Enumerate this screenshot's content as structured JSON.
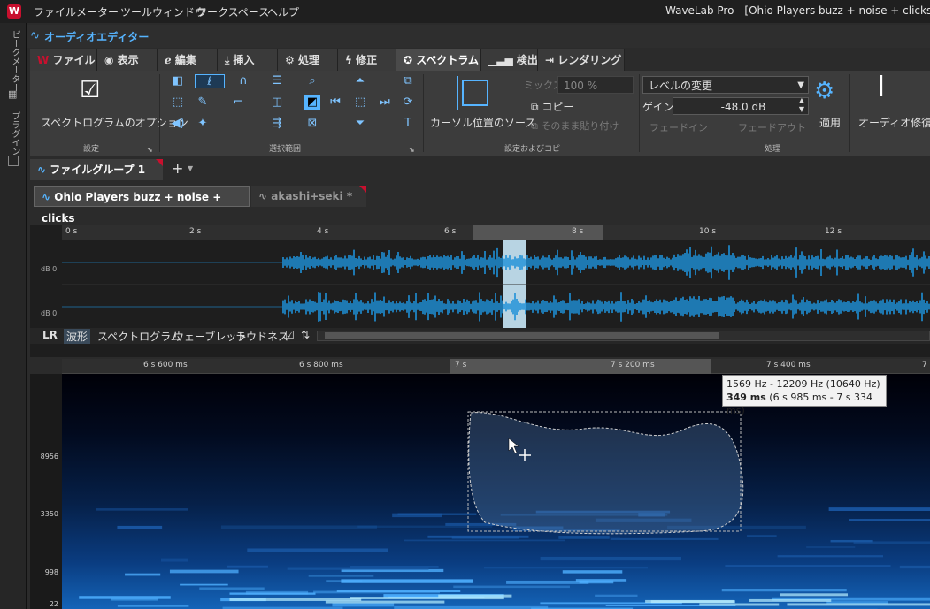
{
  "window": {
    "app_title": "WaveLab Pro - [Ohio Players buzz + noise + clicks.wav (C",
    "menus": [
      "ファイル",
      "メーター",
      "ツールウィンドウ",
      "ワークスペース",
      "ヘルプ"
    ]
  },
  "left_strip": {
    "label_meters": "ピークメーター",
    "label_plugins": "プラグイン"
  },
  "editor": {
    "title": "オーディオエディター",
    "tabs": [
      "ファイル",
      "表示",
      "編集",
      "挿入",
      "処理",
      "修正",
      "スペクトラム",
      "検出",
      "レンダリング"
    ],
    "active_tab": "スペクトラム"
  },
  "ribbon": {
    "spectrogram_options": "スペクトログラムのオプション",
    "group_settings": "設定",
    "group_selection": "選択範囲",
    "cursor_source": "カーソル位置のソース",
    "mix_label": "ミックス",
    "mix_value": "100 %",
    "copy_label": "コピー",
    "paste_as_is": "そのまま貼り付け",
    "group_settings_copy": "設定およびコピー",
    "process_select": "レベルの変更",
    "gain_label": "ゲイン",
    "gain_value": "-48.0 dB",
    "fade_in": "フェードイン",
    "fade_out": "フェードアウト",
    "apply": "適用",
    "audio_repair": "オーディオ修復",
    "group_process": "処理"
  },
  "file_group": {
    "name": "ファイルグループ 1"
  },
  "files": [
    {
      "name": "Ohio Players buzz + noise + clicks",
      "active": true
    },
    {
      "name": "akashi+seki *",
      "active": false
    }
  ],
  "overview": {
    "ticks": [
      "0 s",
      "2 s",
      "4 s",
      "6 s",
      "8 s",
      "10 s",
      "12 s"
    ],
    "channel_labels": [
      "dB 0",
      "dB 0"
    ]
  },
  "view_tabs": {
    "lr": "LR",
    "tabs": [
      "波形",
      "スペクトログラム",
      "ウェーブレット",
      "ラウドネス"
    ],
    "active": "波形"
  },
  "main_ruler": {
    "ticks": [
      "6 s 600 ms",
      "6 s 800 ms",
      "7 s",
      "7 s 200 ms",
      "7 s 400 ms",
      "7"
    ]
  },
  "freq_axis": {
    "labels": [
      "8956",
      "3350",
      "998",
      "22"
    ]
  },
  "tooltip": {
    "line1": "1569 Hz - 12209 Hz (10640 Hz)",
    "line2_bold": "349 ms",
    "line2_rest": " (6 s 985 ms - 7 s 334 ms)"
  },
  "colors": {
    "accent": "#56b4ff",
    "waveform": "#1e90d8",
    "selection": "#b8d4e3",
    "logo": "#c8102e"
  }
}
